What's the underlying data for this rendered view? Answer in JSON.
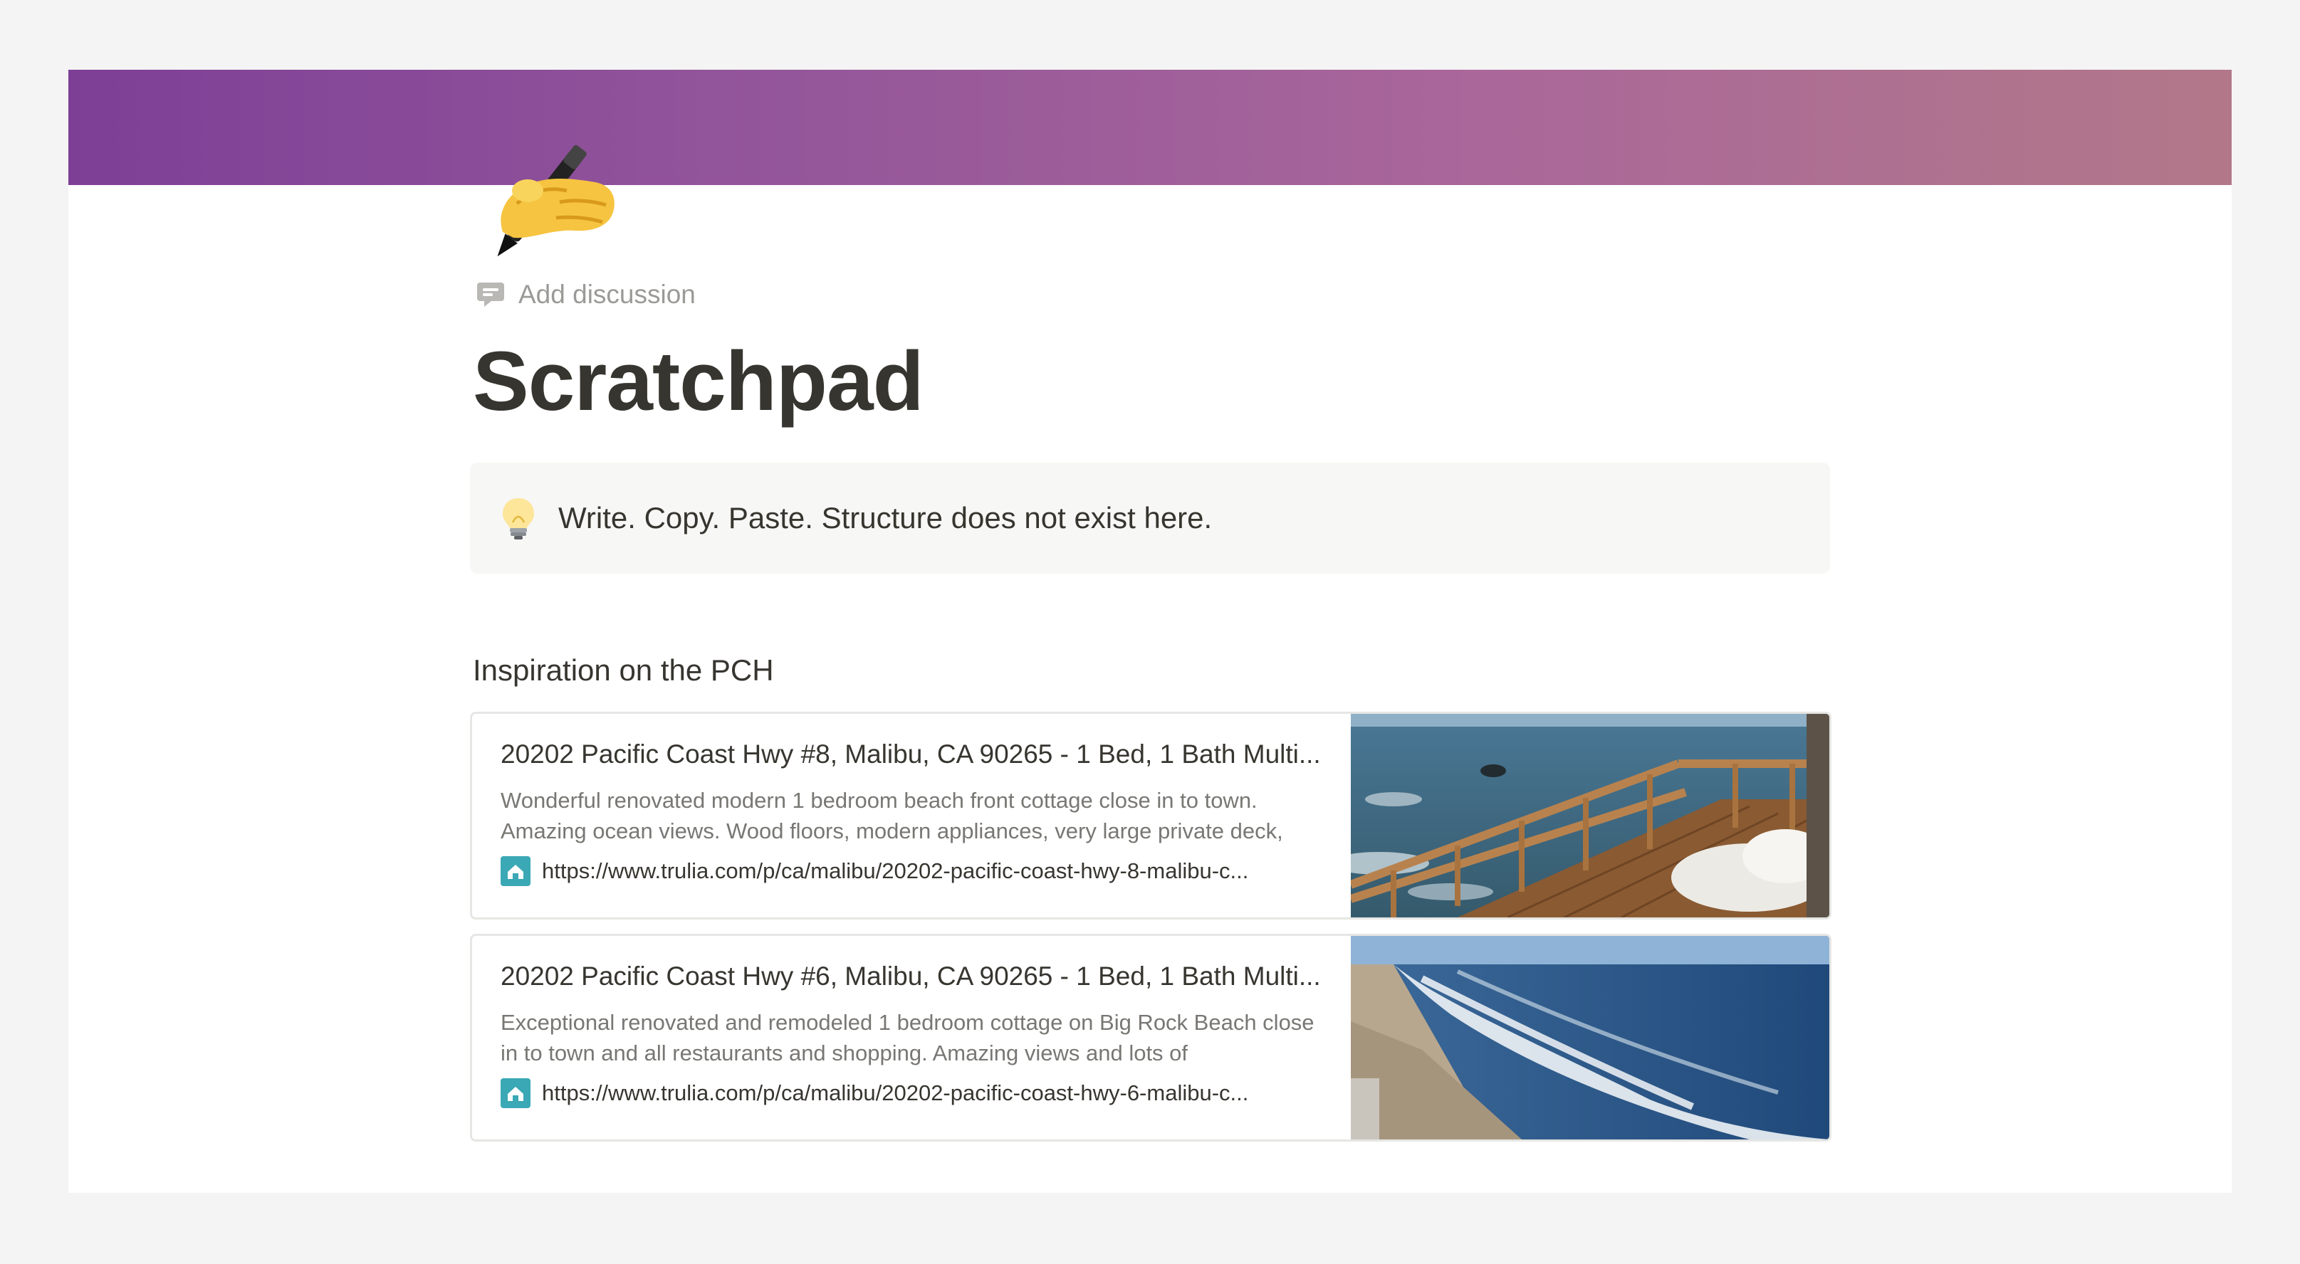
{
  "page": {
    "add_discussion": "Add discussion",
    "title": "Scratchpad",
    "icon": "writing-hand-emoji",
    "cover_colors": [
      "#7d3f96",
      "#b27889"
    ]
  },
  "callout": {
    "icon": "lightbulb-icon",
    "text": "Write. Copy. Paste. Structure does not exist here."
  },
  "section": {
    "heading": "Inspiration on the PCH"
  },
  "bookmarks": [
    {
      "title": "20202 Pacific Coast Hwy #8, Malibu, CA 90265 - 1 Bed, 1 Bath Multi...",
      "description": "Wonderful renovated modern 1 bedroom beach front cottage close in to town. Amazing ocean views. Wood floors, modern appliances, very large private deck,",
      "url": "https://www.trulia.com/p/ca/malibu/20202-pacific-coast-hwy-8-malibu-c...",
      "favicon": "trulia-favicon",
      "thumbnail": "ocean-deck-photo"
    },
    {
      "title": "20202 Pacific Coast Hwy #6, Malibu, CA 90265 - 1 Bed, 1 Bath Multi...",
      "description": "Exceptional renovated and remodeled 1 bedroom cottage on Big Rock Beach close in to town and all restaurants and shopping. Amazing views and lots of",
      "url": "https://www.trulia.com/p/ca/malibu/20202-pacific-coast-hwy-6-malibu-c...",
      "favicon": "trulia-favicon",
      "thumbnail": "beach-waves-photo"
    }
  ]
}
